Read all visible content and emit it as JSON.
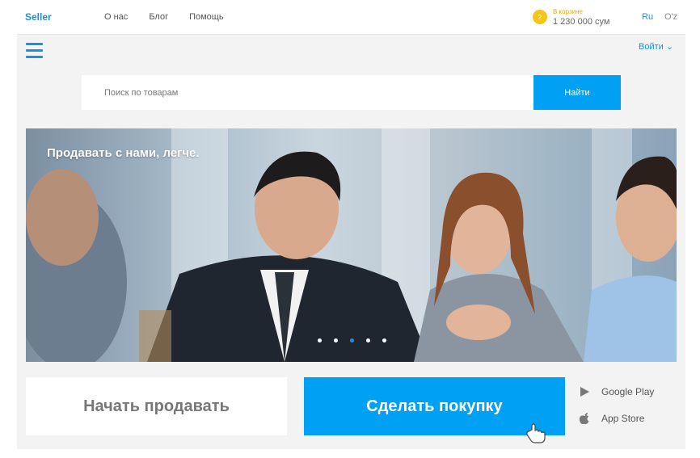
{
  "header": {
    "logo": "Seller",
    "nav": [
      "О нас",
      "Блог",
      "Помощь"
    ],
    "cart": {
      "badge": "2",
      "label": "В корзине",
      "amount": "1 230 000 сум"
    },
    "languages": {
      "ru": "Ru",
      "uz": "O'z"
    }
  },
  "menu": {
    "login_label": "Войти ⌄"
  },
  "search": {
    "placeholder": "Поиск по товарам",
    "button_label": "Найти"
  },
  "banner": {
    "title": "Продавать с нами, легче.",
    "slide_count": 5,
    "active_slide": 3
  },
  "actions": {
    "sell_label": "Начать продавать",
    "buy_label": "Сделать покупку"
  },
  "stores": {
    "google_play": "Google Play",
    "app_store": "App Store"
  },
  "colors": {
    "accent": "#00a0f5",
    "brand": "#1a8fe3",
    "cart_badge": "#f5c518"
  },
  "icons": [
    "hamburger-menu-icon",
    "google-play-icon",
    "apple-icon",
    "hand-cursor-icon"
  ]
}
